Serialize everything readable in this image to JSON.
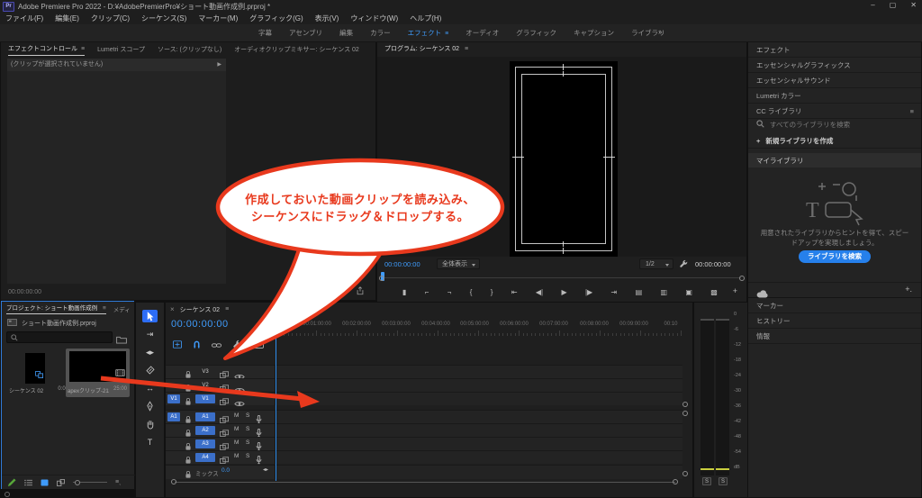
{
  "window": {
    "logo": "Pr",
    "title": "Adobe Premiere Pro 2022 - D:¥AdobePremierPro¥ショート動画作成例.prproj *",
    "minimize": "–",
    "maximize": "▢",
    "close": "✕"
  },
  "menu_bar": [
    "ファイル(F)",
    "編集(E)",
    "クリップ(C)",
    "シーケンス(S)",
    "マーカー(M)",
    "グラフィック(G)",
    "表示(V)",
    "ウィンドウ(W)",
    "ヘルプ(H)"
  ],
  "workspace_bar": {
    "tabs": [
      {
        "label": "字幕",
        "active": false
      },
      {
        "label": "アセンブリ",
        "active": false
      },
      {
        "label": "編集",
        "active": false
      },
      {
        "label": "カラー",
        "active": false
      },
      {
        "label": "エフェクト",
        "active": true
      },
      {
        "label": "オーディオ",
        "active": false
      },
      {
        "label": "グラフィック",
        "active": false
      },
      {
        "label": "キャプション",
        "active": false
      },
      {
        "label": "ライブラリ",
        "active": false
      }
    ],
    "overflow": "»"
  },
  "effect_controls": {
    "tabs": [
      {
        "label": "エフェクトコントロール",
        "active": true
      },
      {
        "label": "Lumetri スコープ",
        "active": false
      },
      {
        "label": "ソース: (クリップなし)",
        "active": false
      },
      {
        "label": "オーディオクリップミキサー: シーケンス 02",
        "active": false
      }
    ],
    "empty_message": "(クリップが選択されていません)",
    "timecode": "00:00:00:00"
  },
  "program_monitor": {
    "title": "プログラム: シーケンス 02",
    "current_timecode": "00:00:00:00",
    "fit_mode": "全体表示",
    "playback_resolution": "1/2",
    "duration_timecode": "00:00:00:00",
    "transport": [
      {
        "name": "add-marker",
        "glyph": "▮"
      },
      {
        "name": "mark-in",
        "glyph": "⌐"
      },
      {
        "name": "mark-out",
        "glyph": "¬"
      },
      {
        "name": "go-to-in",
        "glyph": "{"
      },
      {
        "name": "go-to-out",
        "glyph": "}"
      },
      {
        "name": "jump-to-in",
        "glyph": "⇤"
      },
      {
        "name": "step-back",
        "glyph": "◀|"
      },
      {
        "name": "play",
        "glyph": "▶"
      },
      {
        "name": "step-forward",
        "glyph": "|▶"
      },
      {
        "name": "jump-to-out",
        "glyph": "⇥"
      },
      {
        "name": "lift",
        "glyph": "▤"
      },
      {
        "name": "extract",
        "glyph": "▥"
      },
      {
        "name": "export-frame",
        "glyph": "▣"
      },
      {
        "name": "comparison-view",
        "glyph": "▩"
      }
    ],
    "button_editor": "+"
  },
  "right_sidebar": {
    "panels_top": [
      "エフェクト",
      "エッセンシャルグラフィックス",
      "エッセンシャルサウンド",
      "Lumetri カラー"
    ],
    "cc_libraries": {
      "title": "CC ライブラリ",
      "search_placeholder": "すべてのライブラリを検索",
      "create_library": "新規ライブラリを作成",
      "library_name": "マイライブラリ",
      "hint": "用意されたライブラリからヒントを得て、スピードアップを実現しましょう。",
      "search_button": "ライブラリを検索"
    },
    "panels_bottom": [
      "マーカー",
      "ヒストリー",
      "情報"
    ]
  },
  "project_panel": {
    "tab": "プロジェクト: ショート動画作成例",
    "tab_next": "メディ",
    "overflow": "»",
    "project_file": "ショート動画作成例.prproj",
    "items": [
      {
        "name": "シーケンス 02",
        "duration": "0:00",
        "type": "sequence",
        "selected": false
      },
      {
        "name": "apexクリップ-21111...",
        "duration": "25:00",
        "type": "video",
        "selected": true
      }
    ]
  },
  "tools": [
    {
      "name": "selection-tool",
      "active": true
    },
    {
      "name": "track-select-forward-tool",
      "active": false
    },
    {
      "name": "ripple-edit-tool",
      "active": false
    },
    {
      "name": "razor-tool",
      "active": false
    },
    {
      "name": "slip-tool",
      "active": false
    },
    {
      "name": "pen-tool",
      "active": false
    },
    {
      "name": "hand-tool",
      "active": false
    },
    {
      "name": "type-tool",
      "active": false
    }
  ],
  "timeline": {
    "close": "×",
    "tab": "シーケンス 02",
    "timecode": "00:00:00:00",
    "ruler": [
      ":00:00",
      "00:01:00:00",
      "00:02:00:00",
      "00:03:00:00",
      "00:04:00:00",
      "00:05:00:00",
      "00:06:00:00",
      "00:07:00:00",
      "00:08:00:00",
      "00:09:00:00",
      "00:10"
    ],
    "video_tracks": [
      {
        "name": "V3",
        "targeted": false,
        "source": ""
      },
      {
        "name": "V2",
        "targeted": false,
        "source": ""
      },
      {
        "name": "V1",
        "targeted": true,
        "source": "V1"
      }
    ],
    "audio_tracks": [
      {
        "name": "A1",
        "targeted": true,
        "source": "A1"
      },
      {
        "name": "A2",
        "targeted": true,
        "source": ""
      },
      {
        "name": "A3",
        "targeted": true,
        "source": ""
      },
      {
        "name": "A4",
        "targeted": true,
        "source": ""
      }
    ],
    "mix": {
      "name": "ミックス",
      "value": "0.0"
    },
    "mute_label": "M",
    "solo_label": "S"
  },
  "audio_meter": {
    "scale": [
      "0",
      "-6",
      "-12",
      "-18",
      "-24",
      "-30",
      "-36",
      "-42",
      "-48",
      "-54",
      "dB"
    ],
    "solo": "S"
  },
  "callout": {
    "line1": "作成しておいた動画クリップを読み込み、",
    "line2": "シーケンスにドラッグ＆ドロップする。"
  },
  "colors": {
    "accent": "#2d8ceb",
    "timecode_blue": "#3f9bfa",
    "track_blue": "#3b6fc9",
    "callout_red": "#e8391d",
    "library_button_blue": "#2680eb"
  }
}
